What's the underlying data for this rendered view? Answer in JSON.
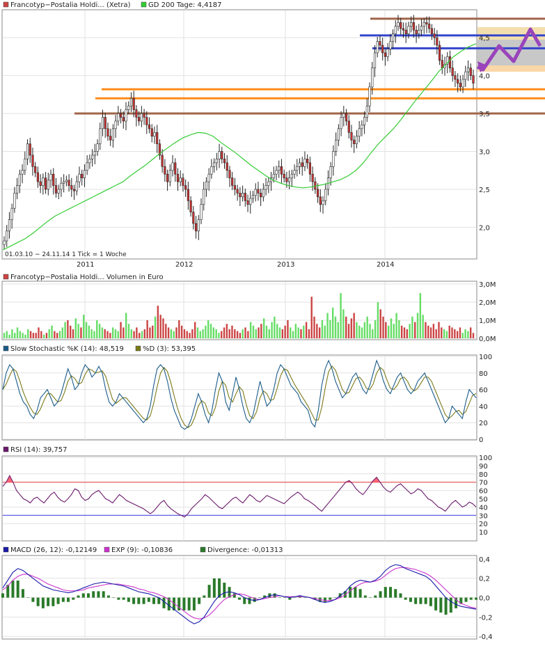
{
  "chart_data": [
    {
      "type": "candlestick",
      "panel": "price",
      "legend": [
        {
          "label": "Francotyp−Postalia Holdi... (Xetra)",
          "color": "#cc4444"
        },
        {
          "label": "GD 200 Tage: 4,4187",
          "color": "#33cc33"
        }
      ],
      "info_text": "01.03.10 − 24.11.14   1 Tick = 1 Woche",
      "x_ticks": [
        "2011",
        "2012",
        "2013",
        "2014"
      ],
      "y_ticks": [
        "2,0",
        "2,5",
        "3,0",
        "3,5",
        "4,0",
        "4,5"
      ],
      "ylim": [
        1.6,
        4.85
      ],
      "close_series": [
        1.82,
        1.95,
        2.1,
        2.25,
        2.45,
        2.55,
        2.7,
        2.75,
        2.9,
        3.1,
        2.95,
        2.8,
        2.72,
        2.6,
        2.55,
        2.65,
        2.5,
        2.62,
        2.7,
        2.55,
        2.45,
        2.5,
        2.58,
        2.6,
        2.62,
        2.55,
        2.5,
        2.48,
        2.6,
        2.7,
        2.65,
        2.75,
        2.85,
        2.9,
        2.95,
        3.0,
        3.1,
        3.3,
        3.45,
        3.3,
        3.2,
        3.15,
        3.3,
        3.4,
        3.5,
        3.45,
        3.4,
        3.55,
        3.6,
        3.7,
        3.55,
        3.45,
        3.4,
        3.5,
        3.45,
        3.35,
        3.3,
        3.2,
        3.25,
        3.1,
        2.95,
        2.8,
        2.7,
        2.6,
        2.75,
        2.85,
        2.7,
        2.6,
        2.65,
        2.55,
        2.5,
        2.35,
        2.2,
        2.05,
        1.95,
        2.1,
        2.3,
        2.5,
        2.6,
        2.7,
        2.8,
        2.85,
        2.9,
        3.0,
        2.9,
        2.85,
        2.75,
        2.65,
        2.55,
        2.5,
        2.45,
        2.4,
        2.45,
        2.35,
        2.3,
        2.38,
        2.42,
        2.5,
        2.45,
        2.4,
        2.5,
        2.55,
        2.6,
        2.65,
        2.7,
        2.75,
        2.8,
        2.7,
        2.65,
        2.6,
        2.65,
        2.7,
        2.75,
        2.8,
        2.85,
        2.8,
        2.9,
        2.85,
        2.7,
        2.6,
        2.5,
        2.4,
        2.3,
        2.35,
        2.5,
        2.65,
        2.8,
        3.0,
        3.15,
        3.3,
        3.45,
        3.5,
        3.4,
        3.25,
        3.15,
        3.1,
        3.2,
        3.3,
        3.35,
        3.45,
        3.6,
        3.85,
        4.1,
        4.3,
        4.45,
        4.4,
        4.3,
        4.25,
        4.35,
        4.45,
        4.55,
        4.65,
        4.7,
        4.62,
        4.6,
        4.55,
        4.65,
        4.7,
        4.6,
        4.55,
        4.6,
        4.65,
        4.7,
        4.68,
        4.62,
        4.55,
        4.5,
        4.4,
        4.2,
        4.1,
        4.15,
        4.25,
        4.1,
        4.0,
        3.95,
        3.9,
        3.85,
        3.95,
        4.05,
        4.1,
        4.0,
        3.9
      ],
      "ma200_series": [
        1.7,
        1.75,
        1.8,
        1.85,
        1.92,
        2.0,
        2.08,
        2.15,
        2.2,
        2.25,
        2.3,
        2.35,
        2.4,
        2.45,
        2.5,
        2.55,
        2.6,
        2.68,
        2.75,
        2.82,
        2.9,
        2.98,
        3.05,
        3.12,
        3.18,
        3.22,
        3.25,
        3.24,
        3.2,
        3.12,
        3.05,
        2.98,
        2.9,
        2.82,
        2.75,
        2.68,
        2.62,
        2.58,
        2.55,
        2.53,
        2.52,
        2.53,
        2.55,
        2.57,
        2.6,
        2.63,
        2.68,
        2.75,
        2.85,
        2.98,
        3.1,
        3.2,
        3.3,
        3.42,
        3.55,
        3.68,
        3.8,
        3.92,
        4.05,
        4.15,
        4.25,
        4.32,
        4.38,
        4.42
      ],
      "horizontal_lines": [
        {
          "level": 4.75,
          "color": "#a0654a"
        },
        {
          "level": 4.53,
          "color": "#3344cc"
        },
        {
          "level": 4.36,
          "color": "#3344cc"
        },
        {
          "level": 3.82,
          "color": "#ff8c1a"
        },
        {
          "level": 3.7,
          "color": "#ff8c1a"
        },
        {
          "level": 3.5,
          "color": "#a0654a"
        }
      ],
      "colors": {
        "up": "#333333",
        "down": "#cc3333",
        "ma": "#33cc33",
        "forecast": "#9944bb"
      }
    },
    {
      "type": "bar",
      "panel": "volume",
      "legend": [
        {
          "label": "Francotyp−Postalia Holdi... Volumen in Euro",
          "color": "#cc4444"
        }
      ],
      "y_ticks": [
        "0,0M",
        "1,0M",
        "2,0M",
        "3,0M"
      ],
      "ylim": [
        0,
        3.0
      ],
      "values_m": [
        0.3,
        0.4,
        0.2,
        0.5,
        0.3,
        0.6,
        0.4,
        0.3,
        0.2,
        0.5,
        0.4,
        0.3,
        0.3,
        0.6,
        0.4,
        0.2,
        0.3,
        0.5,
        0.7,
        0.4,
        0.3,
        0.4,
        0.6,
        0.9,
        1.0,
        0.7,
        0.5,
        1.1,
        0.8,
        0.6,
        1.3,
        0.9,
        0.7,
        0.5,
        0.4,
        1.0,
        0.8,
        0.6,
        0.5,
        0.4,
        0.3,
        0.6,
        0.5,
        0.4,
        0.9,
        0.6,
        1.4,
        0.8,
        0.5,
        0.4,
        0.6,
        0.3,
        0.4,
        0.5,
        1.0,
        0.6,
        0.7,
        1.2,
        1.8,
        1.3,
        1.1,
        0.8,
        0.6,
        0.5,
        0.4,
        0.6,
        1.0,
        0.7,
        0.5,
        0.4,
        0.3,
        0.5,
        0.9,
        0.6,
        0.4,
        0.5,
        0.7,
        1.0,
        0.8,
        0.6,
        0.5,
        0.3,
        0.4,
        0.6,
        0.8,
        0.5,
        0.7,
        0.5,
        0.4,
        0.3,
        0.5,
        0.6,
        0.4,
        0.9,
        0.7,
        0.5,
        0.6,
        0.8,
        1.1,
        0.7,
        0.5,
        0.9,
        1.2,
        0.8,
        0.6,
        0.5,
        0.7,
        1.0,
        0.6,
        0.4,
        0.8,
        0.6,
        0.5,
        0.7,
        0.9,
        0.5,
        2.3,
        1.2,
        0.8,
        0.6,
        1.0,
        0.7,
        1.4,
        1.0,
        1.7,
        1.2,
        0.9,
        2.5,
        1.6,
        1.2,
        0.8,
        1.1,
        1.4,
        0.9,
        0.7,
        0.6,
        0.9,
        1.2,
        0.8,
        0.5,
        1.0,
        2.0,
        1.6,
        1.2,
        0.9,
        0.7,
        1.1,
        0.8,
        1.4,
        1.0,
        0.7,
        0.6,
        0.5,
        0.8,
        1.2,
        0.9,
        1.4,
        2.5,
        1.3,
        0.9,
        0.7,
        0.6,
        0.8,
        0.5,
        0.9,
        0.6,
        0.5,
        0.4,
        0.7,
        0.6,
        0.5,
        0.4,
        0.6,
        0.3,
        0.5,
        0.4,
        0.6,
        0.3
      ],
      "colors": {
        "up": "#66dd66",
        "down": "#cc4444"
      }
    },
    {
      "type": "line",
      "panel": "stochastic",
      "legend": [
        {
          "label": "Slow Stochastic %K (14): 48,519",
          "color": "#1a5c8a"
        },
        {
          "label": "%D (3): 53,395",
          "color": "#7a7a1a"
        }
      ],
      "y_ticks": [
        "0",
        "20",
        "40",
        "60",
        "80",
        "100"
      ],
      "ylim": [
        0,
        100
      ],
      "k_series": [
        60,
        80,
        90,
        85,
        70,
        55,
        45,
        40,
        30,
        25,
        35,
        50,
        55,
        60,
        50,
        40,
        45,
        55,
        70,
        85,
        75,
        60,
        65,
        80,
        90,
        85,
        75,
        80,
        88,
        80,
        60,
        45,
        40,
        45,
        55,
        50,
        45,
        40,
        35,
        30,
        25,
        20,
        25,
        40,
        65,
        85,
        90,
        85,
        70,
        50,
        35,
        25,
        15,
        12,
        15,
        25,
        40,
        55,
        45,
        30,
        20,
        35,
        60,
        80,
        70,
        45,
        35,
        55,
        75,
        60,
        40,
        25,
        20,
        30,
        50,
        70,
        55,
        40,
        45,
        60,
        80,
        90,
        85,
        75,
        65,
        60,
        55,
        45,
        40,
        35,
        20,
        15,
        35,
        65,
        85,
        95,
        85,
        70,
        60,
        50,
        55,
        65,
        75,
        80,
        70,
        60,
        55,
        65,
        80,
        95,
        85,
        70,
        60,
        55,
        65,
        75,
        80,
        70,
        60,
        55,
        60,
        70,
        75,
        80,
        70,
        60,
        50,
        40,
        30,
        20,
        25,
        40,
        35,
        30,
        25,
        45,
        60,
        55,
        50
      ],
      "colors": {
        "k": "#1a5c8a",
        "d": "#7a7a1a"
      }
    },
    {
      "type": "line",
      "panel": "rsi",
      "legend": [
        {
          "label": "RSI (14): 39,757",
          "color": "#6a1a6a"
        }
      ],
      "y_ticks": [
        "10",
        "20",
        "30",
        "40",
        "50",
        "60",
        "70",
        "80",
        "90",
        "100"
      ],
      "overbought_label": "70",
      "oversold_label": "30",
      "ylim": [
        0,
        100
      ],
      "series": [
        65,
        70,
        78,
        70,
        60,
        55,
        50,
        48,
        45,
        50,
        52,
        48,
        45,
        50,
        55,
        58,
        52,
        48,
        46,
        50,
        55,
        62,
        60,
        52,
        48,
        50,
        55,
        58,
        60,
        55,
        50,
        48,
        45,
        50,
        55,
        52,
        48,
        46,
        44,
        42,
        40,
        38,
        35,
        32,
        35,
        40,
        45,
        48,
        42,
        38,
        35,
        32,
        30,
        28,
        32,
        38,
        42,
        46,
        50,
        55,
        52,
        48,
        44,
        40,
        38,
        42,
        46,
        50,
        52,
        48,
        45,
        50,
        55,
        52,
        48,
        46,
        50,
        54,
        52,
        50,
        48,
        46,
        44,
        48,
        52,
        55,
        58,
        55,
        50,
        48,
        45,
        42,
        38,
        35,
        40,
        45,
        50,
        55,
        60,
        65,
        70,
        72,
        68,
        62,
        58,
        55,
        60,
        66,
        72,
        76,
        70,
        64,
        60,
        58,
        62,
        66,
        68,
        64,
        60,
        56,
        58,
        62,
        60,
        55,
        50,
        48,
        44,
        40,
        38,
        35,
        40,
        45,
        48,
        44,
        40,
        42,
        46,
        44,
        40
      ],
      "colors": {
        "line": "#6a1a6a",
        "ob": "#dd3333",
        "os": "#3333dd",
        "fill": "#ff6677"
      }
    },
    {
      "type": "bar+line",
      "panel": "macd",
      "legend": [
        {
          "label": "MACD (26, 12): -0,12149",
          "color": "#1a1aaa"
        },
        {
          "label": "EXP (9): -0,10836",
          "color": "#cc33cc"
        },
        {
          "label": "Divergence: -0,01313",
          "color": "#2a7a2a"
        }
      ],
      "y_ticks": [
        "0,4",
        "0,2",
        "0,0",
        "-0,2",
        "-0,4"
      ],
      "ylim": [
        -0.42,
        0.42
      ],
      "macd_series": [
        0.1,
        0.18,
        0.26,
        0.3,
        0.28,
        0.24,
        0.2,
        0.16,
        0.12,
        0.1,
        0.08,
        0.07,
        0.06,
        0.05,
        0.06,
        0.08,
        0.1,
        0.12,
        0.14,
        0.15,
        0.16,
        0.15,
        0.14,
        0.13,
        0.12,
        0.1,
        0.08,
        0.06,
        0.05,
        0.04,
        0.02,
        0.0,
        -0.04,
        -0.08,
        -0.12,
        -0.16,
        -0.2,
        -0.24,
        -0.27,
        -0.25,
        -0.2,
        -0.12,
        -0.04,
        0.02,
        0.05,
        0.06,
        0.05,
        0.03,
        0.0,
        -0.02,
        -0.03,
        -0.02,
        0.0,
        0.02,
        0.03,
        0.02,
        0.01,
        0.0,
        0.01,
        0.02,
        0.01,
        0.0,
        -0.02,
        -0.04,
        -0.05,
        -0.04,
        -0.02,
        0.02,
        0.06,
        0.12,
        0.16,
        0.18,
        0.17,
        0.16,
        0.18,
        0.22,
        0.28,
        0.32,
        0.34,
        0.33,
        0.3,
        0.28,
        0.26,
        0.24,
        0.22,
        0.18,
        0.12,
        0.06,
        0.0,
        -0.04,
        -0.07,
        -0.09,
        -0.1,
        -0.11,
        -0.12
      ],
      "signal_series": [
        0.08,
        0.12,
        0.18,
        0.22,
        0.24,
        0.24,
        0.22,
        0.2,
        0.17,
        0.14,
        0.12,
        0.1,
        0.08,
        0.07,
        0.07,
        0.07,
        0.08,
        0.1,
        0.11,
        0.12,
        0.13,
        0.14,
        0.14,
        0.14,
        0.13,
        0.12,
        0.11,
        0.09,
        0.08,
        0.06,
        0.05,
        0.03,
        0.01,
        -0.02,
        -0.06,
        -0.1,
        -0.14,
        -0.18,
        -0.21,
        -0.22,
        -0.21,
        -0.18,
        -0.13,
        -0.07,
        -0.02,
        0.01,
        0.03,
        0.04,
        0.03,
        0.01,
        -0.01,
        -0.02,
        -0.01,
        0.0,
        0.01,
        0.02,
        0.01,
        0.01,
        0.01,
        0.01,
        0.01,
        0.0,
        -0.01,
        -0.02,
        -0.03,
        -0.03,
        -0.02,
        0.0,
        0.03,
        0.07,
        0.11,
        0.14,
        0.16,
        0.16,
        0.17,
        0.19,
        0.23,
        0.27,
        0.3,
        0.31,
        0.31,
        0.3,
        0.29,
        0.27,
        0.25,
        0.22,
        0.18,
        0.13,
        0.08,
        0.03,
        -0.02,
        -0.06,
        -0.08,
        -0.1,
        -0.11
      ],
      "colors": {
        "macd": "#1a1aaa",
        "signal": "#cc33cc",
        "hist": "#2a7a2a"
      }
    }
  ]
}
